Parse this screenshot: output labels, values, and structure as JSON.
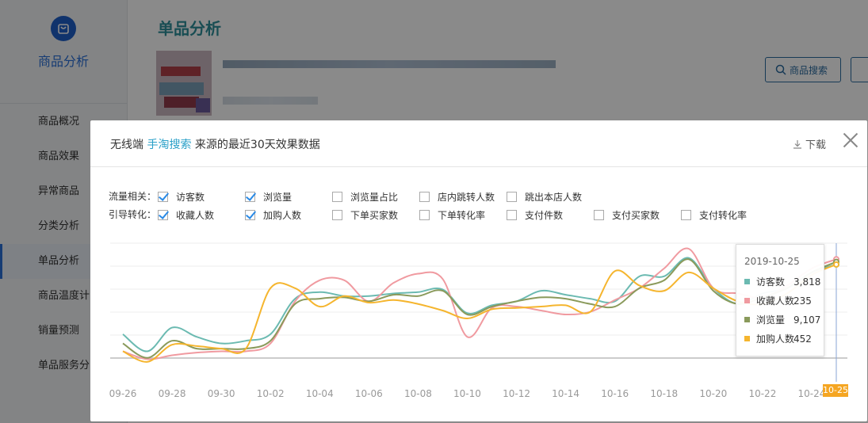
{
  "sidebar": {
    "brand": "商品分析",
    "items": [
      {
        "label": "商品概况"
      },
      {
        "label": "商品效果"
      },
      {
        "label": "异常商品"
      },
      {
        "label": "分类分析"
      },
      {
        "label": "单品分析"
      },
      {
        "label": "商品温度计"
      },
      {
        "label": "销量预测"
      },
      {
        "label": "单品服务分"
      }
    ],
    "active_index": 4
  },
  "main": {
    "title": "单品分析",
    "search_button": "商品搜索"
  },
  "modal": {
    "title_prefix": "无线端",
    "title_keyword": "手淘搜索",
    "title_suffix": "来源的最近30天效果数据",
    "download_label": "下载",
    "traffic_row_label": "流量相关：",
    "conversion_row_label": "引导转化：",
    "traffic_options": [
      {
        "label": "访客数",
        "checked": true
      },
      {
        "label": "浏览量",
        "checked": true
      },
      {
        "label": "浏览量占比",
        "checked": false
      },
      {
        "label": "店内跳转人数",
        "checked": false
      },
      {
        "label": "跳出本店人数",
        "checked": false
      }
    ],
    "conversion_options": [
      {
        "label": "收藏人数",
        "checked": true
      },
      {
        "label": "加购人数",
        "checked": true
      },
      {
        "label": "下单买家数",
        "checked": false
      },
      {
        "label": "下单转化率",
        "checked": false
      },
      {
        "label": "支付件数",
        "checked": false
      },
      {
        "label": "支付买家数",
        "checked": false
      },
      {
        "label": "支付转化率",
        "checked": false
      }
    ]
  },
  "tooltip": {
    "date": "2019-10-25",
    "rows": [
      {
        "name": "访客数",
        "value": "3,818"
      },
      {
        "name": "收藏人数",
        "value": "235"
      },
      {
        "name": "浏览量",
        "value": "9,107"
      },
      {
        "name": "加购人数",
        "value": "452"
      }
    ]
  },
  "chart_data": {
    "type": "line",
    "x": [
      "09-26",
      "09-27",
      "09-28",
      "09-29",
      "09-30",
      "10-01",
      "10-02",
      "10-03",
      "10-04",
      "10-05",
      "10-06",
      "10-07",
      "10-08",
      "10-09",
      "10-10",
      "10-11",
      "10-12",
      "10-13",
      "10-14",
      "10-15",
      "10-16",
      "10-17",
      "10-18",
      "10-19",
      "10-20",
      "10-21",
      "10-22",
      "10-23",
      "10-24",
      "10-25"
    ],
    "x_tick_labels": [
      "09-26",
      "09-28",
      "09-30",
      "10-02",
      "10-04",
      "10-06",
      "10-08",
      "10-10",
      "10-12",
      "10-14",
      "10-16",
      "10-18",
      "10-20",
      "10-22",
      "10-24"
    ],
    "highlight_x_label": "10-25",
    "y_axis_labels_shown": false,
    "gridlines": true,
    "series": [
      {
        "name": "访客数",
        "color": "#6bbab1",
        "values": [
          0.35,
          0.22,
          0.4,
          0.33,
          0.28,
          0.3,
          0.35,
          0.62,
          0.67,
          0.64,
          0.64,
          0.66,
          0.67,
          0.69,
          0.51,
          0.57,
          0.6,
          0.68,
          0.65,
          0.62,
          0.6,
          0.79,
          0.79,
          0.93,
          0.7,
          0.58,
          0.66,
          0.7,
          0.82,
          0.88
        ]
      },
      {
        "name": "收藏人数",
        "color": "#f09aa0",
        "values": [
          0.22,
          0.16,
          0.19,
          0.21,
          0.22,
          0.22,
          0.28,
          0.6,
          0.76,
          0.76,
          0.6,
          0.74,
          0.81,
          0.77,
          0.33,
          0.55,
          0.56,
          0.53,
          0.5,
          0.52,
          0.61,
          0.7,
          0.85,
          1.0,
          0.7,
          0.66,
          0.63,
          0.72,
          0.85,
          0.92
        ]
      },
      {
        "name": "浏览量",
        "color": "#8a9a5b",
        "values": [
          0.28,
          0.17,
          0.3,
          0.24,
          0.24,
          0.24,
          0.3,
          0.58,
          0.62,
          0.63,
          0.6,
          0.65,
          0.64,
          0.68,
          0.5,
          0.56,
          0.6,
          0.63,
          0.62,
          0.58,
          0.56,
          0.7,
          0.76,
          0.92,
          0.68,
          0.58,
          0.63,
          0.7,
          0.82,
          0.9
        ]
      },
      {
        "name": "加购人数",
        "color": "#f5b52e",
        "values": [
          0.22,
          0.14,
          0.27,
          0.26,
          0.24,
          0.24,
          0.7,
          0.7,
          0.56,
          0.64,
          0.59,
          0.61,
          0.58,
          0.53,
          0.47,
          0.54,
          0.55,
          0.56,
          0.57,
          0.52,
          0.83,
          0.72,
          0.68,
          0.82,
          0.7,
          0.6,
          0.58,
          0.66,
          0.8,
          0.88
        ]
      }
    ]
  }
}
